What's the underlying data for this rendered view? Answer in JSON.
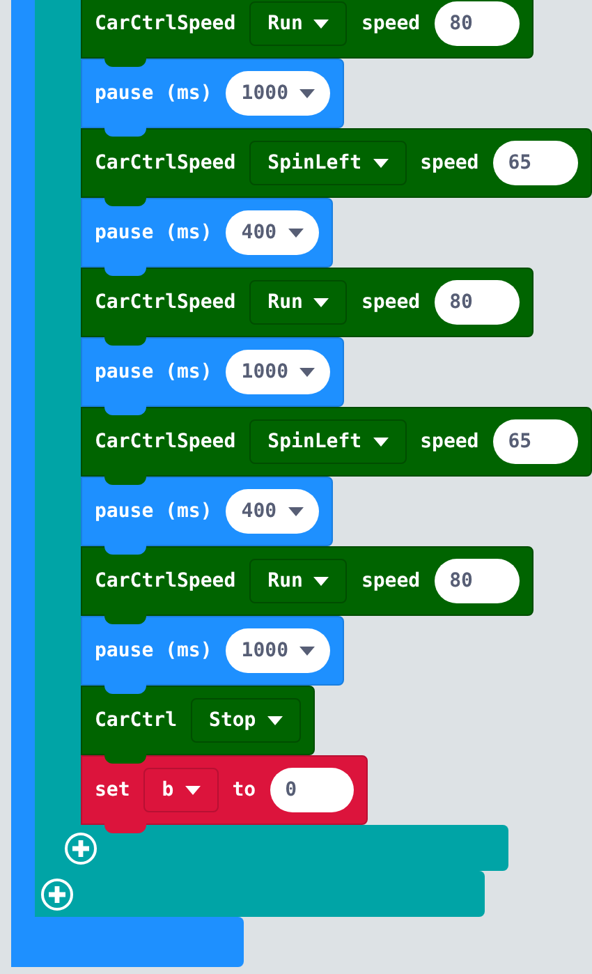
{
  "blocks": [
    {
      "kind": "car_speed",
      "label": "CarCtrlSpeed",
      "dropdown": "Run",
      "speed_label": "speed",
      "value": "80"
    },
    {
      "kind": "pause",
      "label": "pause (ms)",
      "dropdown": "1000"
    },
    {
      "kind": "car_speed",
      "label": "CarCtrlSpeed",
      "dropdown": "SpinLeft",
      "speed_label": "speed",
      "value": "65"
    },
    {
      "kind": "pause",
      "label": "pause (ms)",
      "dropdown": "400"
    },
    {
      "kind": "car_speed",
      "label": "CarCtrlSpeed",
      "dropdown": "Run",
      "speed_label": "speed",
      "value": "80"
    },
    {
      "kind": "pause",
      "label": "pause (ms)",
      "dropdown": "1000"
    },
    {
      "kind": "car_speed",
      "label": "CarCtrlSpeed",
      "dropdown": "SpinLeft",
      "speed_label": "speed",
      "value": "65"
    },
    {
      "kind": "pause",
      "label": "pause (ms)",
      "dropdown": "400"
    },
    {
      "kind": "car_speed",
      "label": "CarCtrlSpeed",
      "dropdown": "Run",
      "speed_label": "speed",
      "value": "80"
    },
    {
      "kind": "pause",
      "label": "pause (ms)",
      "dropdown": "1000"
    },
    {
      "kind": "car",
      "label": "CarCtrl",
      "dropdown": "Stop"
    },
    {
      "kind": "set",
      "label": "set",
      "variable": "b",
      "to_label": "to",
      "value": "0"
    }
  ]
}
